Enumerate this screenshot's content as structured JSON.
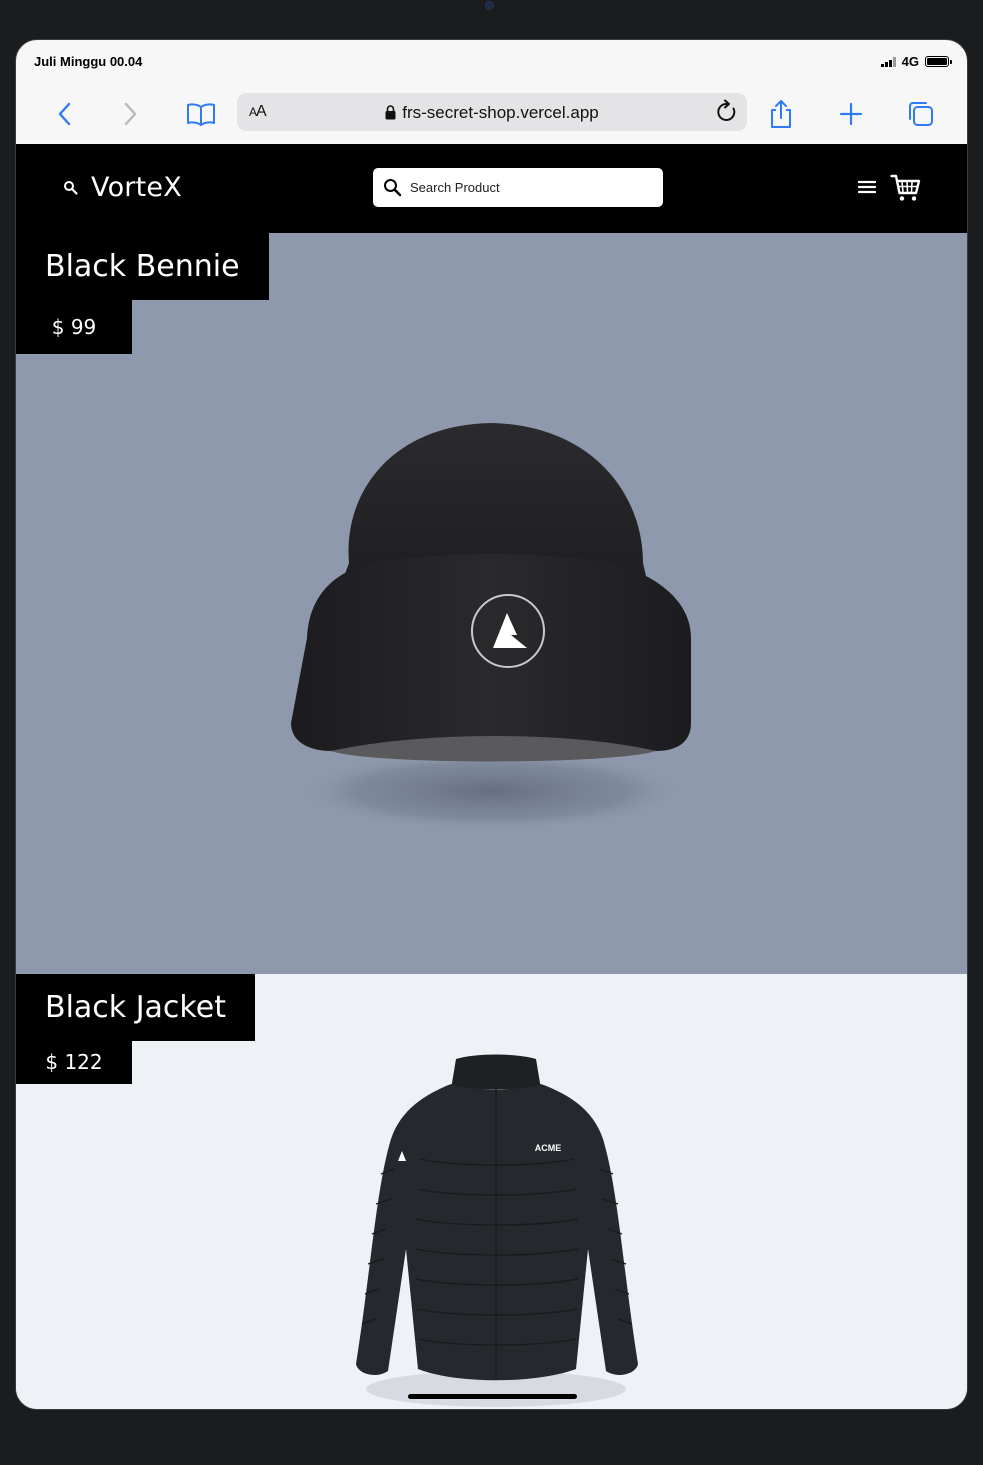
{
  "status": {
    "time": "Juli Minggu 00.04",
    "network": "4G"
  },
  "browser": {
    "text_size_label": "AA",
    "url": "frs-secret-shop.vercel.app",
    "icons": [
      "back-icon",
      "forward-icon",
      "bookmarks-icon",
      "lock-icon",
      "reload-icon",
      "share-icon",
      "new-tab-icon",
      "tabs-icon"
    ]
  },
  "site": {
    "brand": "VorteX",
    "search": {
      "placeholder": "Search Product",
      "value": ""
    }
  },
  "products": [
    {
      "name": "Black Bennie",
      "price": "$ 99",
      "logo_text": ""
    },
    {
      "name": "Black Jacket",
      "price": "$ 122",
      "logo_text": "ACME"
    }
  ],
  "colors": {
    "header": "#000000",
    "product1_bg": "#8e99ad",
    "product2_bg": "#eef1f5",
    "accent": "#2f7bf5"
  }
}
